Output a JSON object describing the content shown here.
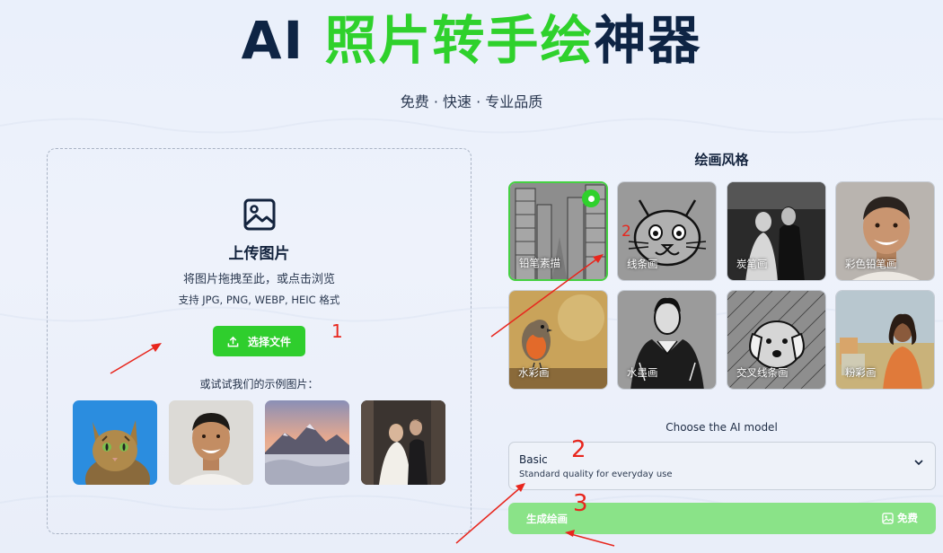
{
  "header": {
    "title_ai": "AI",
    "title_green": "照片转手绘",
    "title_dark": "神器",
    "subtitle": "免费 · 快速 · 专业品质"
  },
  "upload": {
    "icon": "image-icon",
    "title": "上传图片",
    "hint": "将图片拖拽至此，或点击浏览",
    "formats": "支持 JPG, PNG, WEBP, HEIC 格式",
    "button_label": "选择文件",
    "button_icon": "upload-icon",
    "examples_label": "或试试我们的示例图片：",
    "examples": [
      "cat",
      "smiling-man",
      "mountain-sunset",
      "wedding-couple"
    ]
  },
  "styles": {
    "title": "绘画风格",
    "selected_index": 0,
    "items": [
      {
        "label": "铅笔素描"
      },
      {
        "label": "线条画"
      },
      {
        "label": "炭笔画"
      },
      {
        "label": "彩色铅笔画"
      },
      {
        "label": "水彩画"
      },
      {
        "label": "水墨画"
      },
      {
        "label": "交叉线条画"
      },
      {
        "label": "粉彩画"
      }
    ]
  },
  "model": {
    "label": "Choose the AI model",
    "selected_name": "Basic",
    "selected_desc": "Standard quality for everyday use"
  },
  "generate": {
    "label": "生成绘画",
    "free_label": "免费",
    "free_icon": "image-icon"
  },
  "annotations": {
    "marks": [
      "1",
      "2",
      "2",
      "3"
    ],
    "color": "#e8261d"
  },
  "colors": {
    "brand_green": "#2fd12c",
    "title_dark": "#0e2444",
    "generate_bg": "#8ae388"
  }
}
